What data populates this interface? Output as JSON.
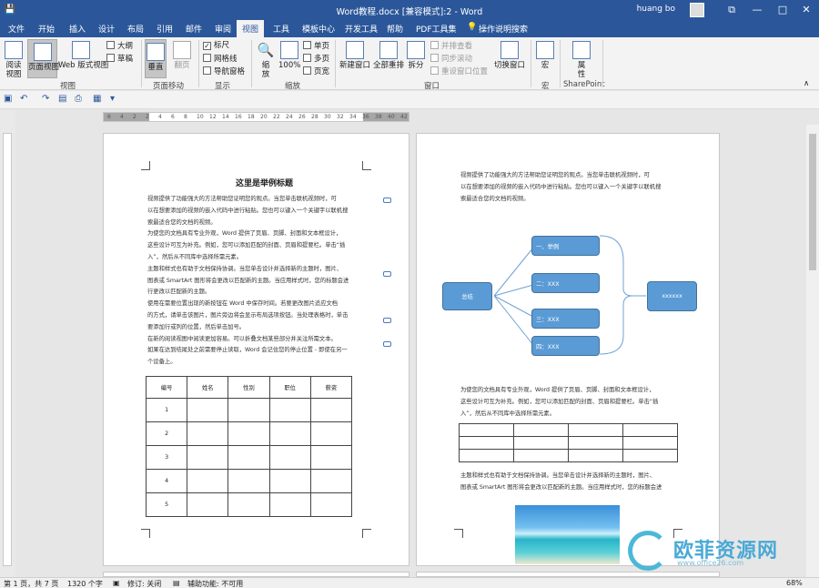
{
  "window": {
    "title": "Word教程.docx [兼容模式]:2 - Word",
    "user": "huang bo",
    "min": "—",
    "restore": "□",
    "close": "✕",
    "ribbon_opts": "⧉"
  },
  "tabs": [
    "文件",
    "开始",
    "插入",
    "设计",
    "布局",
    "引用",
    "邮件",
    "审阅",
    "视图",
    "工具",
    "模板中心",
    "开发工具",
    "帮助",
    "PDF工具集",
    "操作说明搜索"
  ],
  "active_tab": "视图",
  "ribbon": {
    "views": {
      "read": "阅读\n视图",
      "print": "页面视图",
      "web": "Web 版式视图",
      "outline": "大纲",
      "draft": "草稿",
      "label": "视图"
    },
    "page_move": {
      "vertical": "垂直",
      "side": "翻页",
      "label": "页面移动"
    },
    "show": {
      "ruler": "标尺",
      "grid": "网格线",
      "nav": "导航窗格",
      "label": "显示"
    },
    "zoom": {
      "zoom": "缩\n放",
      "pct": "100%",
      "one": "单页",
      "multi": "多页",
      "width": "页宽",
      "label": "缩放"
    },
    "window": {
      "new": "新建窗口",
      "arrange": "全部重排",
      "split": "拆分",
      "side_by_side": "并排查看",
      "sync": "同步滚动",
      "reset": "重设窗口位置",
      "switch": "切换窗口",
      "label": "窗口"
    },
    "macro": {
      "macro": "宏",
      "label": "宏"
    },
    "sharepoint": {
      "prop": "属\n性",
      "label": "SharePoint"
    },
    "collapse": "∧"
  },
  "ruler_nums": [
    "6",
    "4",
    "2",
    "2",
    "4",
    "6",
    "8",
    "10",
    "12",
    "14",
    "16",
    "18",
    "20",
    "22",
    "24",
    "26",
    "28",
    "30",
    "32",
    "34",
    "36",
    "38",
    "40",
    "42"
  ],
  "page1": {
    "title": "这里是举例标题",
    "lines": [
      "视频提供了功能强大的方法帮助您证明您的观点。当您单击联机视频时，可",
      "以在想要添加的视频的嵌入代码中进行粘贴。您也可以键入一个关键字以联机搜",
      "索最适合您的文档的视频。",
      "为使您的文档具有专业外观，Word 提供了页眉、页脚、封面和文本框设计，",
      "这些设计可互为补充。例如，您可以添加匹配的封面、页眉和提要栏。单击“插",
      "入”，然后从不同库中选择所需元素。",
      "主题和样式也有助于文档保持协调。当您单击设计并选择新的主题时，图片、",
      "图表或 SmartArt 图形将会更改以匹配新的主题。当应用样式时，您的标题会进",
      "行更改以匹配新的主题。",
      "使用在需要位置出现的新按钮在 Word 中保存时间。若要更改图片适应文档",
      "的方式，请单击该图片，图片旁边将会显示布局选项按钮。当处理表格时，单击",
      "要添加行或列的位置，然后单击加号。",
      "在新的阅读视图中阅读更加容易。可以折叠文档某些部分并关注所需文本。",
      "如果在达到结尾处之前需要停止读取，Word 会记住您的停止位置 - 即使在另一",
      "个设备上。"
    ],
    "table_head": [
      "编号",
      "姓名",
      "性别",
      "职位",
      "薪资"
    ],
    "table_rows": [
      "1",
      "2",
      "3",
      "4",
      "5"
    ]
  },
  "page2": {
    "lines_top": [
      "视频提供了功能强大的方法帮助您证明您的观点。当您单击联机视频时，可",
      "以在想要添加的视频的嵌入代码中进行粘贴。您也可以键入一个关键字以联机搜",
      "索最适合您的文档的视频。"
    ],
    "diagram": {
      "root": "总结",
      "items": [
        "一、举例",
        "二：XXX",
        "三：XXX",
        "四：XXX"
      ],
      "right": "xxxxxx"
    },
    "lines_mid": [
      "为使您的文档具有专业外观，Word 提供了页眉、页脚、封面和文本框设计，",
      "这些设计可互为补充。例如，您可以添加匹配的封面、页眉和提要栏。单击“插",
      "入”，然后从不同库中选择所需元素。"
    ],
    "lines_bottom": [
      "主题和样式也有助于文档保持协调。当您单击设计并选择新的主题时，图片、",
      "图表或 SmartArt 图形将会更改以匹配新的主题。当应用样式时，您的标题会进"
    ]
  },
  "status": {
    "page": "第 1 页，共 7 页",
    "words": "1320 个字",
    "track": "修订: 关闭",
    "access": "辅助功能: 不可用",
    "zoom": "68%"
  },
  "watermark": {
    "name": "欧菲资源网",
    "url": "www.office26.com"
  },
  "colors": {
    "accent": "#2b579a",
    "diagram_fill": "#5b9bd5"
  }
}
